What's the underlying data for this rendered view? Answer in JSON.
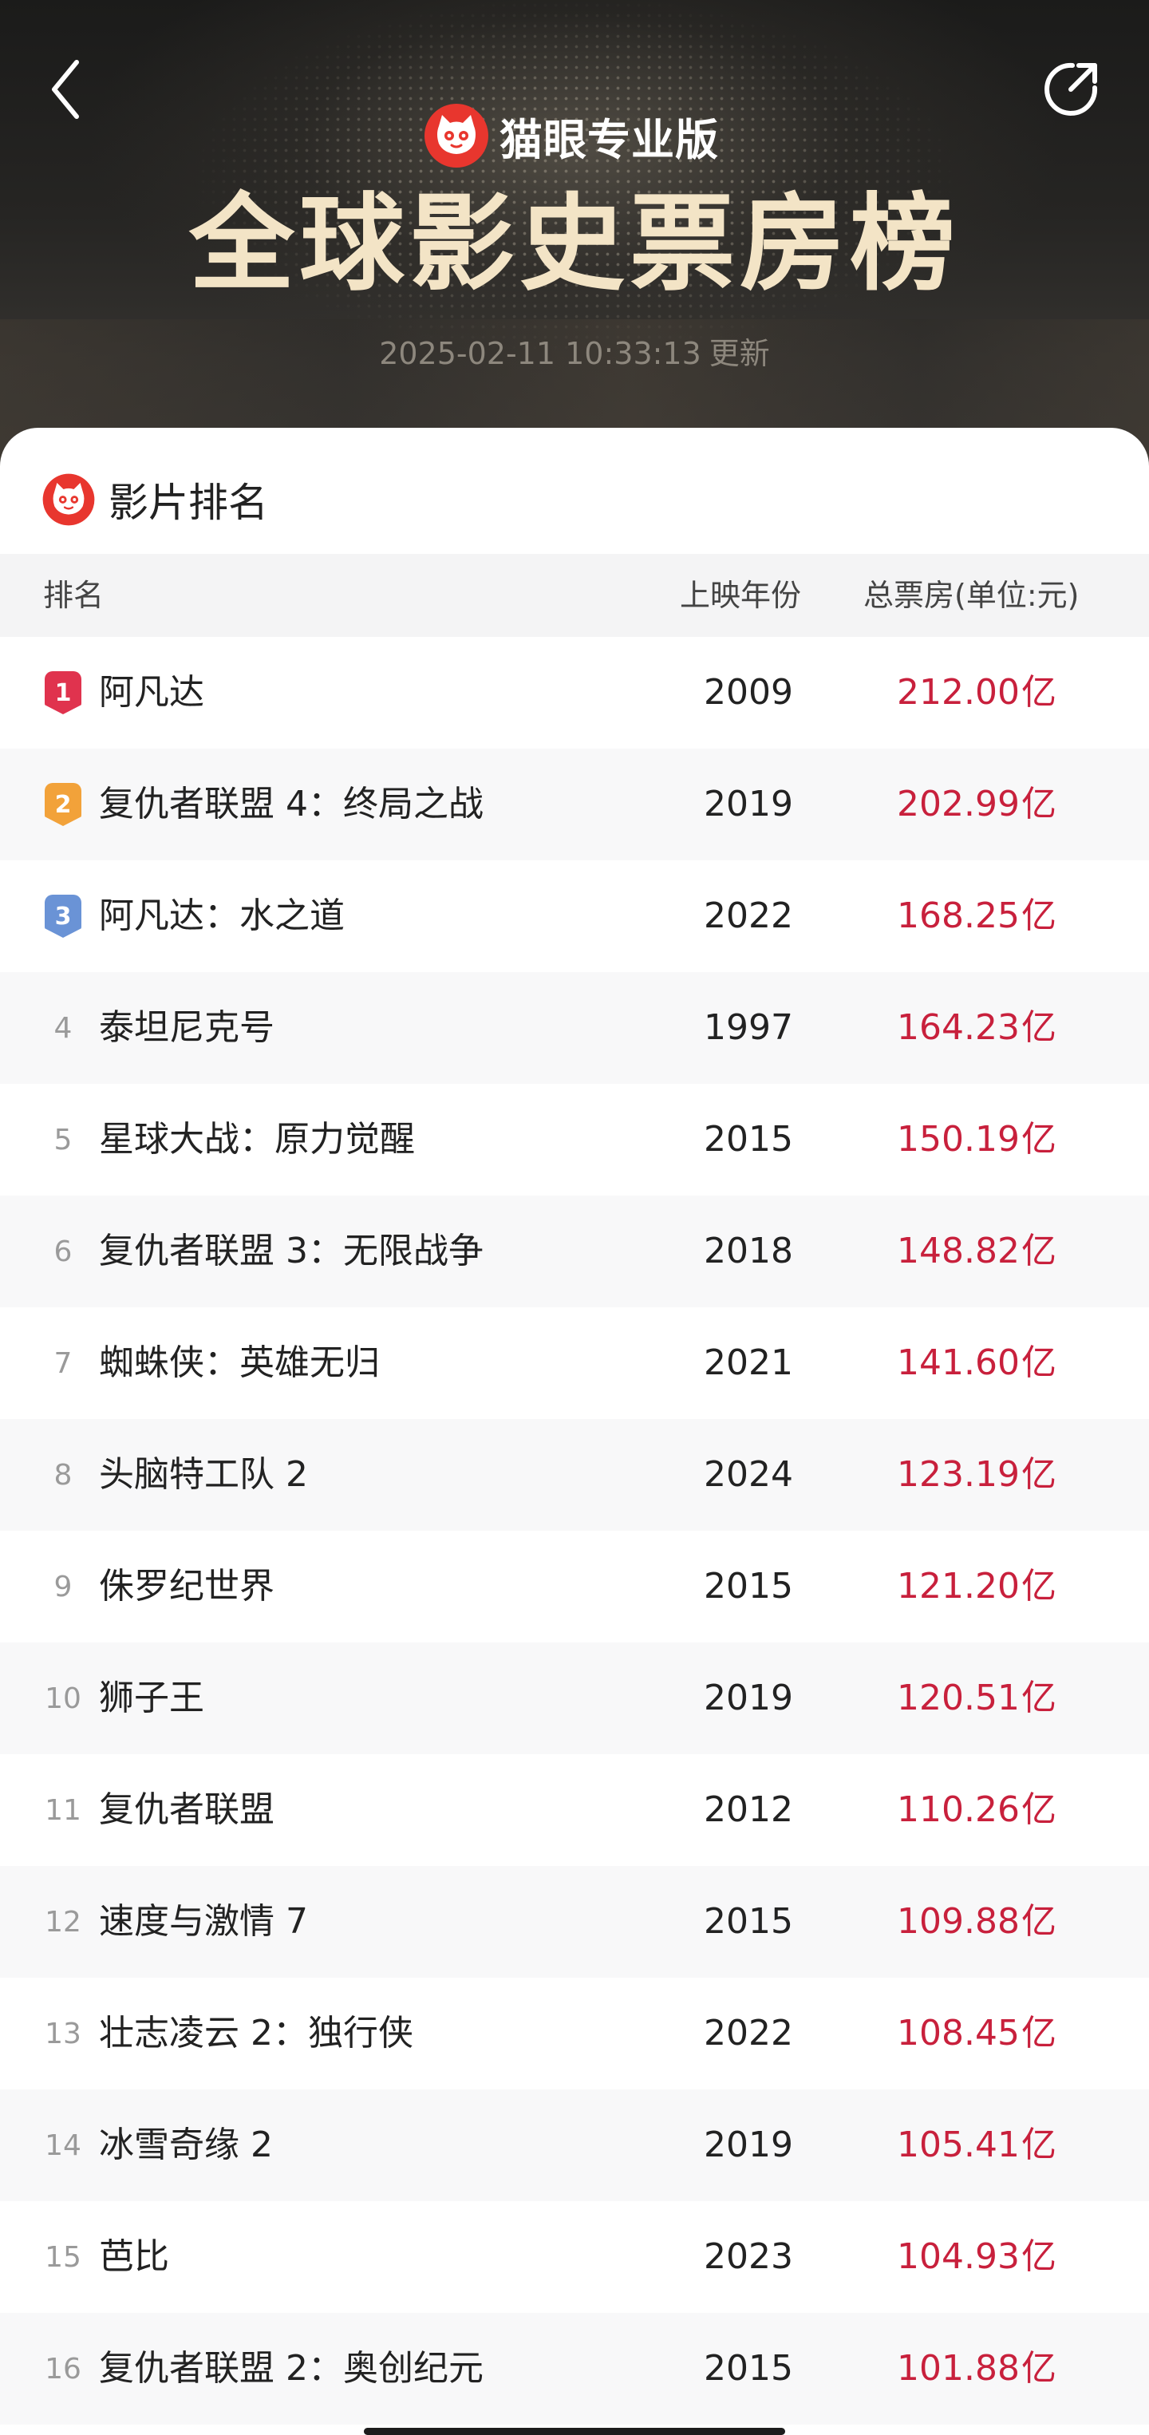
{
  "header": {
    "brand_name": "猫眼专业版",
    "title": "全球影史票房榜",
    "update_time": "2025-02-11 10:33:13",
    "update_label": "更新"
  },
  "card": {
    "title": "影片排名"
  },
  "table": {
    "columns": {
      "rank": "排名",
      "year": "上映年份",
      "gross": "总票房(单位:元)"
    },
    "unit_suffix": "亿",
    "rows": [
      {
        "rank": "1",
        "title": "阿凡达",
        "year": "2009",
        "gross": "212.00"
      },
      {
        "rank": "2",
        "title": "复仇者联盟 4：终局之战",
        "year": "2019",
        "gross": "202.99"
      },
      {
        "rank": "3",
        "title": "阿凡达：水之道",
        "year": "2022",
        "gross": "168.25"
      },
      {
        "rank": "4",
        "title": "泰坦尼克号",
        "year": "1997",
        "gross": "164.23"
      },
      {
        "rank": "5",
        "title": "星球大战：原力觉醒",
        "year": "2015",
        "gross": "150.19"
      },
      {
        "rank": "6",
        "title": "复仇者联盟 3：无限战争",
        "year": "2018",
        "gross": "148.82"
      },
      {
        "rank": "7",
        "title": "蜘蛛侠：英雄无归",
        "year": "2021",
        "gross": "141.60"
      },
      {
        "rank": "8",
        "title": "头脑特工队 2",
        "year": "2024",
        "gross": "123.19"
      },
      {
        "rank": "9",
        "title": "侏罗纪世界",
        "year": "2015",
        "gross": "121.20"
      },
      {
        "rank": "10",
        "title": "狮子王",
        "year": "2019",
        "gross": "120.51"
      },
      {
        "rank": "11",
        "title": "复仇者联盟",
        "year": "2012",
        "gross": "110.26"
      },
      {
        "rank": "12",
        "title": "速度与激情 7",
        "year": "2015",
        "gross": "109.88"
      },
      {
        "rank": "13",
        "title": "壮志凌云 2：独行侠",
        "year": "2022",
        "gross": "108.45"
      },
      {
        "rank": "14",
        "title": "冰雪奇缘 2",
        "year": "2019",
        "gross": "105.41"
      },
      {
        "rank": "15",
        "title": "芭比",
        "year": "2023",
        "gross": "104.93"
      },
      {
        "rank": "16",
        "title": "复仇者联盟 2：奥创纪元",
        "year": "2015",
        "gross": "101.88"
      }
    ]
  },
  "colors": {
    "gross_text": "#c8203c",
    "rank_badge_1": "#e0334e",
    "rank_badge_2": "#f2a23a",
    "rank_badge_3": "#6a93d6",
    "brand_red": "#e8362e",
    "title_gold": "#f3e4c6"
  },
  "icons": {
    "back": "chevron-left-icon",
    "share": "share-icon",
    "brand_logo": "maoyan-cat-logo"
  }
}
